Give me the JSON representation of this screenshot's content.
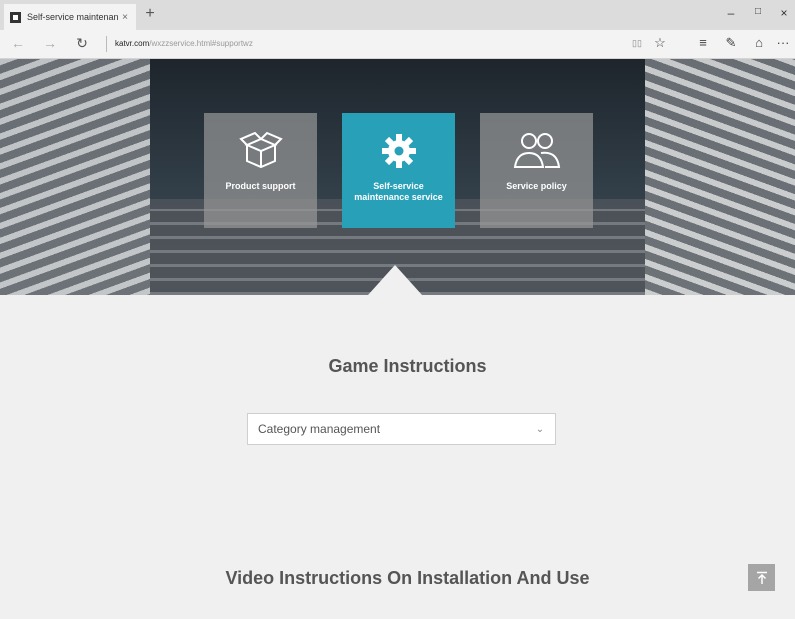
{
  "browser": {
    "tab_title": "Self-service maintenanc",
    "tab_close": "×",
    "new_tab": "+",
    "window_controls": {
      "minimize": "–",
      "maximize": "□",
      "close": "×"
    },
    "nav": {
      "back": "←",
      "forward": "→",
      "refresh": "↻"
    },
    "url_host": "katvr.com",
    "url_path": "/wxzzservice.html#supportwz",
    "toolbar": {
      "reading_view": "▯▯",
      "favorite": "☆",
      "hub": "≡",
      "notes": "✎",
      "share": "⌂",
      "more": "···"
    }
  },
  "hero": {
    "cards": [
      {
        "label": "Product support",
        "icon": "box-icon",
        "active": false
      },
      {
        "label": "Self-service maintenance service",
        "icon": "gear-icon",
        "active": true
      },
      {
        "label": "Service policy",
        "icon": "users-icon",
        "active": false
      }
    ]
  },
  "main": {
    "section_title": "Game Instructions",
    "category_select": {
      "value": "Category management",
      "chevron": "⌄"
    },
    "video_title": "Video Instructions On Installation And Use"
  },
  "colors": {
    "accent": "#27a0b8",
    "card_inactive": "#969696",
    "page_bg": "#f0f0f0",
    "back_to_top": "#a5a5a5"
  }
}
